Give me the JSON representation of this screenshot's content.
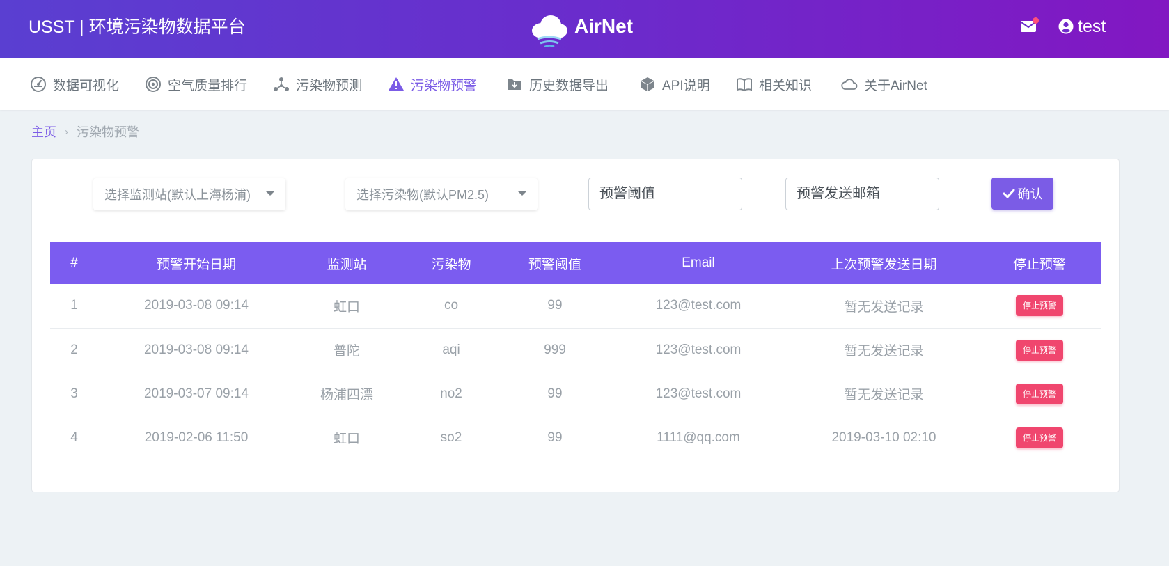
{
  "header": {
    "brand_title": "USST | 环境污染物数据平台",
    "logo_text": "AirNet",
    "user_name": "test"
  },
  "nav": {
    "items": [
      {
        "label": "数据可视化",
        "icon": "dashboard-icon"
      },
      {
        "label": "空气质量排行",
        "icon": "target-icon"
      },
      {
        "label": "污染物预测",
        "icon": "network-icon"
      },
      {
        "label": "污染物预警",
        "icon": "warning-icon",
        "active": true
      },
      {
        "label": "历史数据导出",
        "icon": "folder-download-icon"
      },
      {
        "label": "API说明",
        "icon": "cube-icon"
      },
      {
        "label": "相关知识",
        "icon": "book-icon"
      },
      {
        "label": "关于AirNet",
        "icon": "cloud-icon"
      }
    ]
  },
  "breadcrumb": {
    "home": "主页",
    "current": "污染物预警"
  },
  "form": {
    "station_select": "选择监测站(默认上海杨浦)",
    "pollutant_select": "选择污染物(默认PM2.5)",
    "threshold_placeholder": "预警阈值",
    "email_placeholder": "预警发送邮箱",
    "confirm_label": "确认"
  },
  "table": {
    "headers": [
      "#",
      "预警开始日期",
      "监测站",
      "污染物",
      "预警阈值",
      "Email",
      "上次预警发送日期",
      "停止预警"
    ],
    "stop_label": "停止预警",
    "rows": [
      {
        "index": "1",
        "start": "2019-03-08 09:14",
        "station": "虹口",
        "pollutant": "co",
        "threshold": "99",
        "email": "123@test.com",
        "last_sent": "暂无发送记录"
      },
      {
        "index": "2",
        "start": "2019-03-08 09:14",
        "station": "普陀",
        "pollutant": "aqi",
        "threshold": "999",
        "email": "123@test.com",
        "last_sent": "暂无发送记录"
      },
      {
        "index": "3",
        "start": "2019-03-07 09:14",
        "station": "杨浦四漂",
        "pollutant": "no2",
        "threshold": "99",
        "email": "123@test.com",
        "last_sent": "暂无发送记录"
      },
      {
        "index": "4",
        "start": "2019-02-06 11:50",
        "station": "虹口",
        "pollutant": "so2",
        "threshold": "99",
        "email": "1111@qq.com",
        "last_sent": "2019-03-10 02:10"
      }
    ]
  },
  "colors": {
    "accent": "#7b5ce6",
    "header_gradient_start": "#5a3fd1",
    "header_gradient_end": "#8217c2",
    "danger": "#f0466e"
  }
}
